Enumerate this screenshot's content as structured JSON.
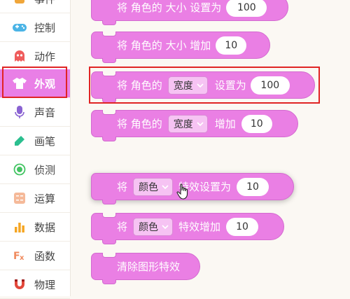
{
  "sidebar": {
    "items": [
      {
        "label": "事件",
        "icon": "event-icon",
        "color": "#f0a63a"
      },
      {
        "label": "控制",
        "icon": "gamepad-icon",
        "color": "#4bb4e6"
      },
      {
        "label": "动作",
        "icon": "ghost-icon",
        "color": "#ef5c5c"
      },
      {
        "label": "外观",
        "icon": "shirt-icon",
        "color": "#ffffff",
        "active": true
      },
      {
        "label": "声音",
        "icon": "microphone-icon",
        "color": "#8a63d2"
      },
      {
        "label": "画笔",
        "icon": "pen-icon",
        "color": "#2bbf8f"
      },
      {
        "label": "侦测",
        "icon": "sensor-icon",
        "color": "#43c463"
      },
      {
        "label": "运算",
        "icon": "calculator-icon",
        "color": "#f08a5d"
      },
      {
        "label": "数据",
        "icon": "bar-chart-icon",
        "color": "#f5a623"
      },
      {
        "label": "函数",
        "icon": "function-icon",
        "color": "#f08a5d"
      },
      {
        "label": "物理",
        "icon": "magnet-icon",
        "color": "#e2483b"
      }
    ]
  },
  "blocks": {
    "size_set": {
      "prefix": "将 角色的 大小 设置为",
      "value": "100"
    },
    "size_add": {
      "prefix": "将 角色的 大小 增加",
      "value": "10"
    },
    "width_set": {
      "prefix": "将 角色的",
      "dropdown": "宽度",
      "suffix": "设置为",
      "value": "100"
    },
    "width_add": {
      "prefix": "将 角色的",
      "dropdown": "宽度",
      "suffix": "增加",
      "value": "10"
    },
    "effect_set": {
      "prefix": "将",
      "dropdown": "颜色",
      "suffix": "特效设置为",
      "value": "10"
    },
    "effect_add": {
      "prefix": "将",
      "dropdown": "颜色",
      "suffix": "特效增加",
      "value": "10"
    },
    "clear_effects": {
      "label": "清除图形特效"
    }
  },
  "colors": {
    "block": "#ea7fe4",
    "highlight": "#e02424",
    "active_category": "#e97fe6"
  }
}
